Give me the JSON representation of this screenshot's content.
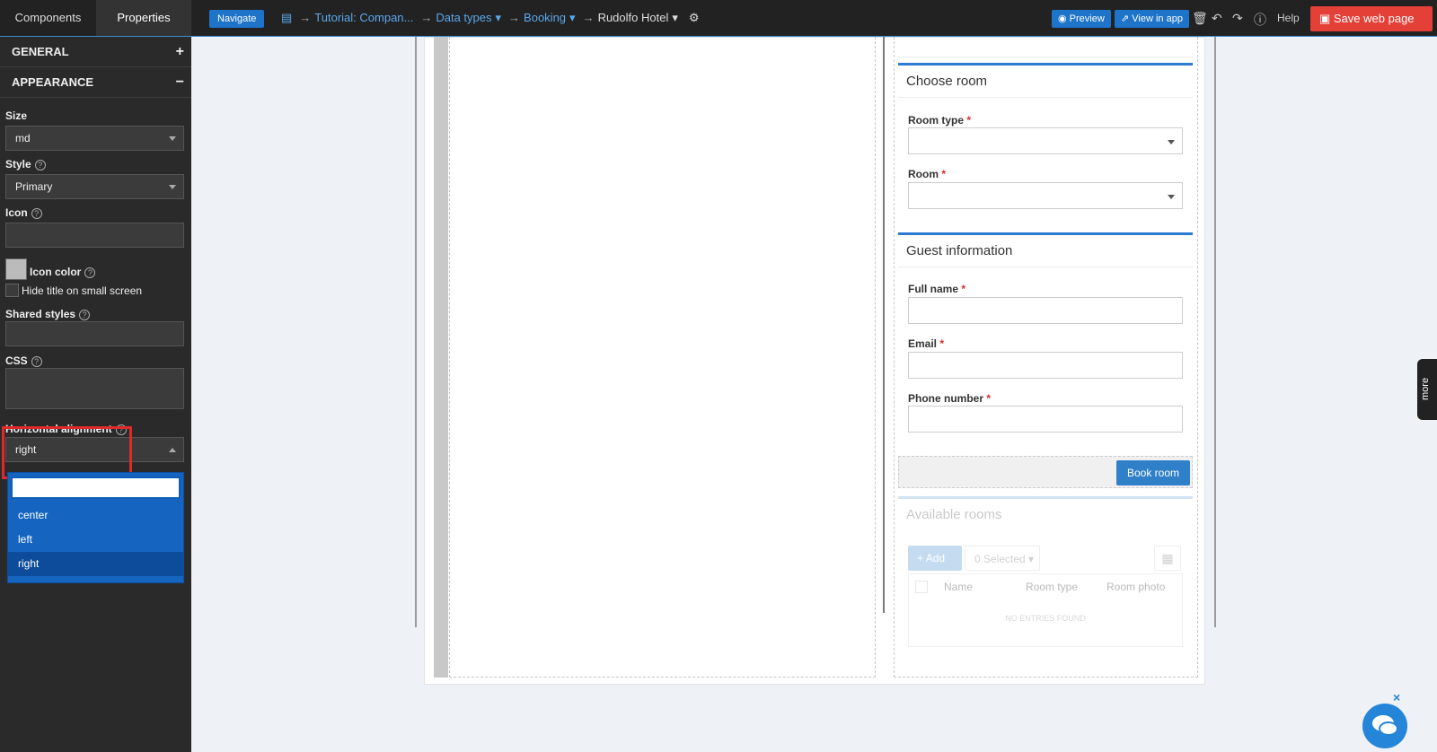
{
  "topbar": {
    "tabs": [
      "Components",
      "Properties"
    ],
    "navigate": "Navigate",
    "breadcrumbs": [
      "Tutorial: Compan...",
      "Data types",
      "Booking",
      "Rudolfo Hotel"
    ],
    "preview": "Preview",
    "view_in_app": "View in app",
    "help": "Help",
    "save": "Save web page"
  },
  "sidebar": {
    "general": "GENERAL",
    "appearance": "APPEARANCE",
    "size_label": "Size",
    "size_value": "md",
    "style_label": "Style",
    "style_value": "Primary",
    "icon_label": "Icon",
    "icon_color_label": "Icon color",
    "hide_title_label": "Hide title on small screen",
    "shared_styles_label": "Shared styles",
    "css_label": "CSS",
    "halign_label": "Horizontal alignment",
    "halign_value": "right",
    "options": [
      "center",
      "left",
      "right"
    ]
  },
  "canvas": {
    "choose_room": "Choose room",
    "room_type": "Room type",
    "room": "Room",
    "guest_info": "Guest information",
    "full_name": "Full name",
    "email": "Email",
    "phone": "Phone number",
    "required_mark": "*",
    "book_room": "Book room",
    "available_rooms": "Available rooms",
    "add": "Add",
    "selected": "0 Selected",
    "columns": [
      "Name",
      "Room type",
      "Room photo"
    ],
    "empty": "NO ENTRIES FOUND"
  },
  "more": "more",
  "colors": {
    "accent": "#1e74c9",
    "save": "#e44038",
    "highlight": "#e02a2a"
  }
}
